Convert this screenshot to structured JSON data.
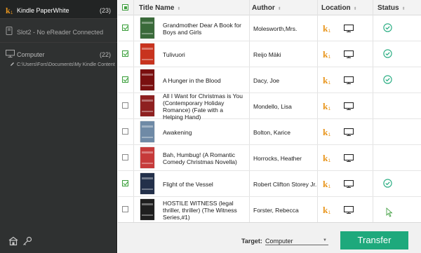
{
  "sidebar": {
    "kindle": {
      "name": "Kindle PaperWhite",
      "count": "(23)"
    },
    "slot": {
      "name": "Slot2 - No eReader Connected"
    },
    "computer": {
      "name": "Computer",
      "count": "(22)",
      "path": "C:\\Users\\Fors\\Documents\\My Kindle Content"
    }
  },
  "header": {
    "title": "Title Name",
    "author": "Author",
    "location": "Location",
    "status": "Status",
    "sort_icon": "sort-arrows-icon"
  },
  "rows": [
    {
      "checked": true,
      "title": "Grandmother Dear A Book for Boys and Girls",
      "author": "Molesworth,Mrs.",
      "on_kindle": true,
      "on_computer": true,
      "status": "synced-check-icon",
      "cover": "#3a6a3a"
    },
    {
      "checked": true,
      "title": "Tulivuori",
      "author": "Reijo Mäki",
      "on_kindle": true,
      "on_computer": true,
      "status": "synced-check-icon",
      "cover": "#c8331e"
    },
    {
      "checked": true,
      "title": "A Hunger in the Blood",
      "author": "Dacy, Joe",
      "on_kindle": true,
      "on_computer": true,
      "status": "synced-check-icon",
      "cover": "#7a1010"
    },
    {
      "checked": false,
      "title": "All I Want for Christmas is You (Contemporary Holiday Romance) (Fate with a Helping Hand)",
      "author": "Mondello, Lisa",
      "on_kindle": true,
      "on_computer": true,
      "status": "",
      "cover": "#8e2020"
    },
    {
      "checked": false,
      "title": "Awakening",
      "author": "Bolton, Karice",
      "on_kindle": true,
      "on_computer": true,
      "status": "",
      "cover": "#6f8aa6"
    },
    {
      "checked": false,
      "title": "Bah, Humbug! (A Romantic Comedy Christmas Novella)",
      "author": "Horrocks, Heather",
      "on_kindle": true,
      "on_computer": true,
      "status": "",
      "cover": "#c63a3a"
    },
    {
      "checked": true,
      "title": "Flight of the Vessel",
      "author": "Robert Clifton Storey Jr.",
      "on_kindle": true,
      "on_computer": true,
      "status": "synced-check-icon",
      "cover": "#23304a"
    },
    {
      "checked": false,
      "title": "HOSTILE WITNESS (legal thriller, thriller) (The Witness Series,#1)",
      "author": "Forster, Rebecca",
      "on_kindle": true,
      "on_computer": true,
      "status": "",
      "cover": "#1f1f1f"
    }
  ],
  "footer": {
    "target_label": "Target:",
    "target_value": "Computer",
    "transfer_label": "Transfer"
  },
  "colors": {
    "accent": "#1ea97c",
    "kindle_orange": "#e8961e",
    "sidebar_bg": "#2f3131"
  }
}
